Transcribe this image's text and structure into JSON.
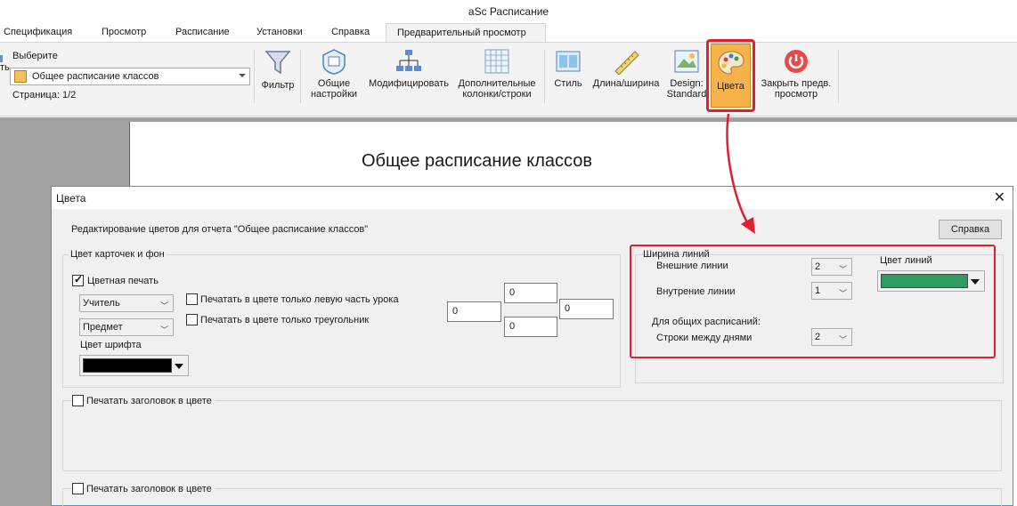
{
  "app": {
    "title": "aSc Расписание"
  },
  "tabs": [
    {
      "label": "Спецификация"
    },
    {
      "label": "Просмотр"
    },
    {
      "label": "Расписание"
    },
    {
      "label": "Установки"
    },
    {
      "label": "Справка"
    },
    {
      "label": "Предварительный просмотр",
      "active": true
    }
  ],
  "ribbon": {
    "left_partial": "ть",
    "select_label": "Выберите",
    "select_value": "Общее расписание классов",
    "page_label": "Страница: 1/2",
    "buttons": {
      "filter": "Фильтр",
      "general_1": "Общие",
      "general_2": "настройки",
      "modify": "Модифицировать",
      "extra_1": "Дополнительные",
      "extra_2": "колонки/строки",
      "style": "Стиль",
      "length": "Длина/ширина",
      "design_1": "Design:",
      "design_2": "Standard",
      "colors": "Цвета",
      "close_1": "Закрыть предв.",
      "close_2": "просмотр"
    }
  },
  "document": {
    "title": "Общее расписание классов"
  },
  "dialog": {
    "title": "Цвета",
    "description": "Редактирование цветов для отчета \"Общее расписание классов\"",
    "help_button": "Справка",
    "card_group": {
      "title": "Цвет карточек и фон",
      "color_print": "Цветная печать",
      "color_print_checked": true,
      "combo1": "Учитель",
      "combo2": "Предмет",
      "font_color_label": "Цвет шрифта",
      "font_color": "#000000",
      "left_part_only": "Печатать в цвете только левую часть урока",
      "triangle_only": "Печатать в цвете только треугольник",
      "margin_top": "0",
      "margin_left": "0",
      "margin_right": "0",
      "margin_bottom": "0"
    },
    "lines": {
      "width_title": "Ширина линий",
      "outer_label": "Внешние линии",
      "outer_value": "2",
      "inner_label": "Внутрение линии",
      "inner_value": "1",
      "general_label": "Для общих расписаний:",
      "rows_label": "Строки между днями",
      "rows_value": "2",
      "color_label": "Цвет линий",
      "color": "#2e9c60"
    },
    "header1": "Печатать заголовок в цвете",
    "header2": "Печатать заголовок в цвете"
  },
  "colors": {
    "highlight": "#e02030",
    "active_button": "#f7b24a"
  }
}
